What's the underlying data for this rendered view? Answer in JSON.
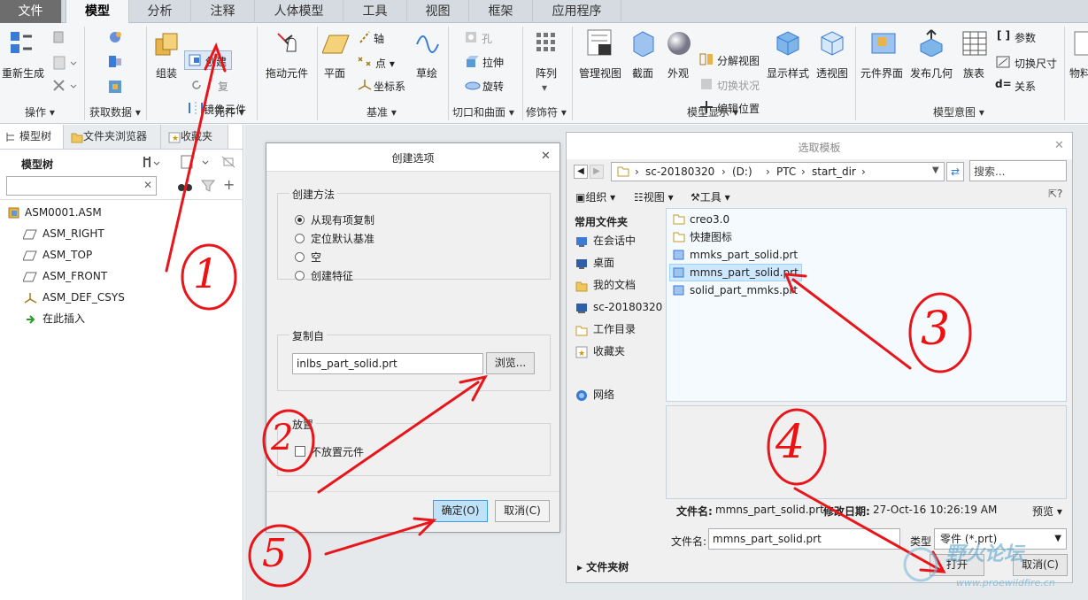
{
  "menu": {
    "tabs": [
      "文件",
      "模型",
      "分析",
      "注释",
      "人体模型",
      "工具",
      "视图",
      "框架",
      "应用程序"
    ]
  },
  "ribbon": {
    "buttons": {
      "regen": "重新生成",
      "create": "创建",
      "assemble": "组装",
      "repeat": "复",
      "mirror": "镜像元件",
      "drag": "拖动元件",
      "plane": "平面",
      "axis": "轴",
      "point": "点",
      "csys": "坐标系",
      "sketch": "草绘",
      "hole": "孔",
      "extrude": "拉伸",
      "revolve": "旋转",
      "pattern": "阵列",
      "manage_view": "管理视图",
      "section": "截面",
      "appearance": "外观",
      "explode": "分解视图",
      "toggle_state": "切换状况",
      "edit_pos": "编辑位置",
      "display_style": "显示样式",
      "perspective": "透视图",
      "comp_interface": "元件界面",
      "publish_geom": "发布几何",
      "family_table": "族表",
      "params": "参数",
      "switch_dim": "切换尺寸",
      "relations": "关系",
      "material": "物料"
    },
    "groups": [
      "操作",
      "获取数据",
      "元件",
      "基准",
      "切口和曲面",
      "修饰符",
      "模型显示",
      "模型意图"
    ]
  },
  "left_panel": {
    "tabs": [
      "模型树",
      "文件夹浏览器",
      "收藏夹"
    ],
    "tree_title": "模型树",
    "search_placeholder": "",
    "items": [
      "ASM0001.ASM",
      "ASM_RIGHT",
      "ASM_TOP",
      "ASM_FRONT",
      "ASM_DEF_CSYS",
      "在此插入"
    ]
  },
  "create_dialog": {
    "title": "创建选项",
    "method_label": "创建方法",
    "options": [
      "从现有项复制",
      "定位默认基准",
      "空",
      "创建特征"
    ],
    "selected_option": "从现有项复制",
    "copy_from_label": "复制自",
    "copy_from_value": "inlbs_part_solid.prt",
    "browse": "浏览...",
    "placement_label": "放置",
    "no_place": "不放置元件",
    "ok": "确定(O)",
    "cancel": "取消(C)"
  },
  "template_dialog": {
    "title": "选取模板",
    "path": [
      "sc-20180320",
      "(D:)",
      "PTC",
      "start_dir"
    ],
    "search_placeholder": "搜索...",
    "toolbar": {
      "organize": "组织",
      "views": "视图",
      "tools": "工具"
    },
    "nav_title": "常用文件夹",
    "nav_items": [
      "在会话中",
      "桌面",
      "我的文档",
      "sc-20180320",
      "工作目录",
      "收藏夹",
      "网络"
    ],
    "files": [
      "creo3.0",
      "快捷图标",
      "mmks_part_solid.prt",
      "mmns_part_solid.prt",
      "solid_part_mmks.prt"
    ],
    "selected_file": "mmns_part_solid.prt",
    "info_name_label": "文件名:",
    "info_name": "mmns_part_solid.prt",
    "info_date_label": "修改日期:",
    "info_date": "27-Oct-16 10:26:19 AM",
    "preview": "预览",
    "filename_label": "文件名:",
    "filename_value": "mmns_part_solid.prt",
    "type_label": "类型",
    "type_value": "零件 (*.prt)",
    "folder_tree": "文件夹树",
    "open": "打开",
    "cancel": "取消(C)"
  },
  "annotations": [
    "1",
    "2",
    "3",
    "4",
    "5"
  ],
  "watermark": {
    "title": "野火论坛",
    "url": "www.proewildfire.cn"
  }
}
